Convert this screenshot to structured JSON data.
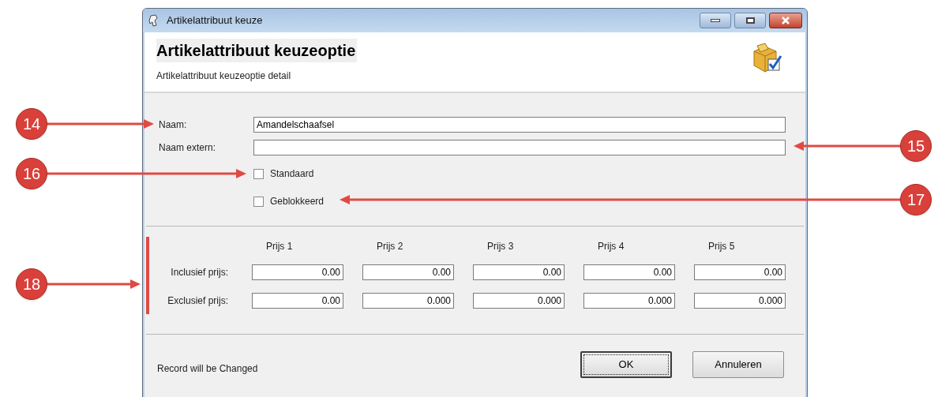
{
  "window": {
    "title": "Artikelattribuut keuze"
  },
  "header": {
    "title": "Artikelattribuut keuzeoptie",
    "subtitle": "Artikelattribuut keuzeoptie detail"
  },
  "fields": [
    {
      "label": "Naam:",
      "value": "Amandelschaafsel"
    },
    {
      "label": "Naam extern:"
    }
  ],
  "checkboxes": [
    {
      "label": "Standaard",
      "checked": false
    },
    {
      "label": "Geblokkeerd",
      "checked": false
    }
  ],
  "prices": {
    "columns": [
      "Prijs 1",
      "Prijs 2",
      "Prijs 3",
      "Prijs 4",
      "Prijs 5"
    ],
    "rows": [
      {
        "label": "Inclusief prijs:",
        "values": [
          "0.00",
          "0.00",
          "0.00",
          "0.00",
          "0.00"
        ]
      },
      {
        "label": "Exclusief prijs:",
        "values": [
          "0.00",
          "0.000",
          "0.000",
          "0.000",
          "0.000"
        ]
      }
    ]
  },
  "status": "Record will be Changed",
  "buttons": [
    {
      "label": "OK",
      "default": true
    },
    {
      "label": "Annuleren",
      "default": false
    }
  ],
  "callouts": [
    {
      "label": "14"
    },
    {
      "label": "15"
    },
    {
      "label": "16"
    },
    {
      "label": "17"
    },
    {
      "label": "18"
    }
  ]
}
